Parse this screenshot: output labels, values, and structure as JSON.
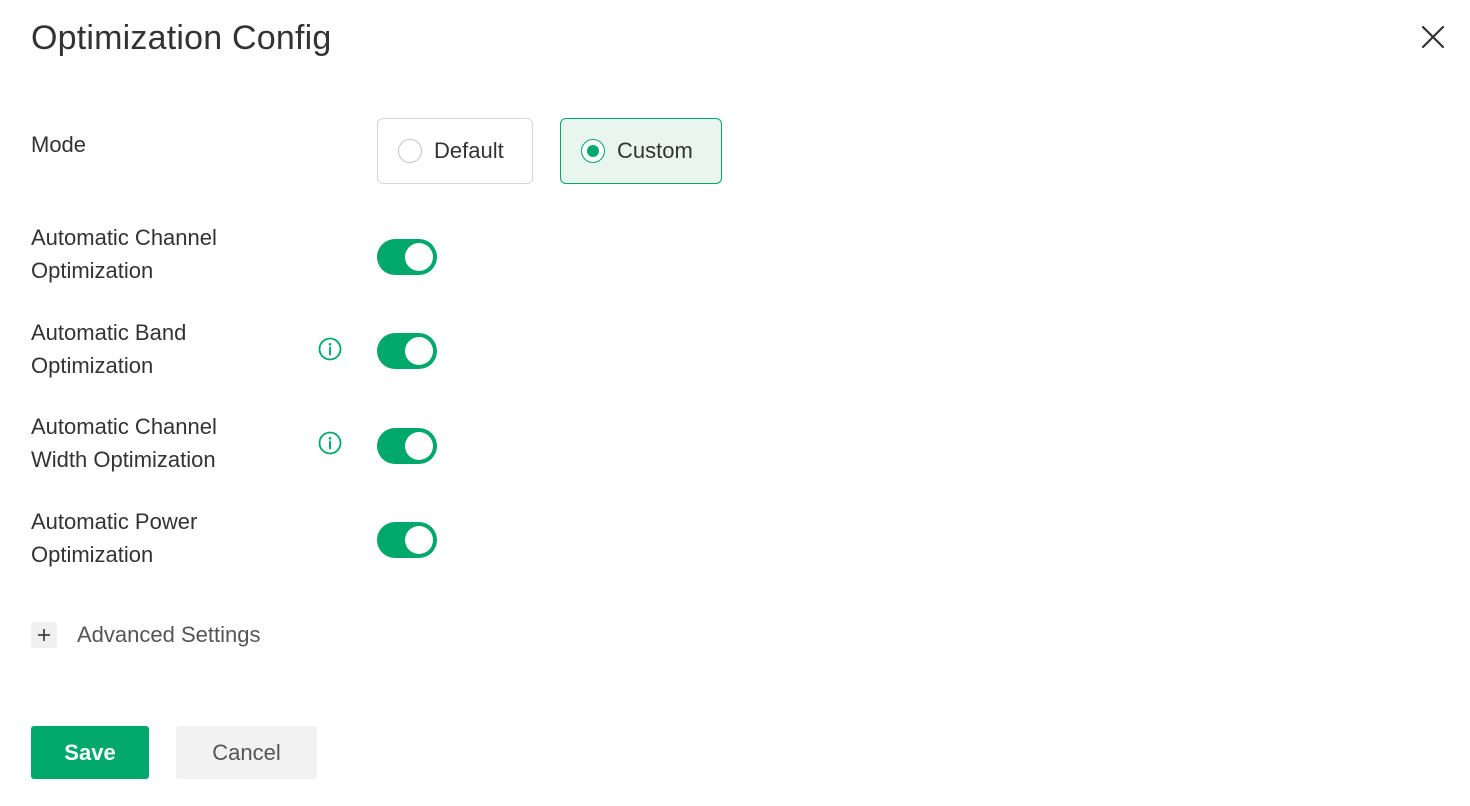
{
  "dialog": {
    "title": "Optimization Config"
  },
  "mode": {
    "label": "Mode",
    "options": [
      {
        "label": "Default",
        "selected": false
      },
      {
        "label": "Custom",
        "selected": true
      }
    ]
  },
  "settings": [
    {
      "label_line1": "Automatic Channel",
      "label_line2": "Optimization",
      "has_info": false,
      "enabled": true
    },
    {
      "label_line1": "Automatic Band",
      "label_line2": "Optimization",
      "has_info": true,
      "enabled": true
    },
    {
      "label_line1": "Automatic Channel",
      "label_line2": "Width Optimization",
      "has_info": true,
      "enabled": true
    },
    {
      "label_line1": "Automatic Power",
      "label_line2": "Optimization",
      "has_info": false,
      "enabled": true
    }
  ],
  "advanced": {
    "label": "Advanced Settings",
    "expanded": false
  },
  "actions": {
    "save_label": "Save",
    "cancel_label": "Cancel"
  },
  "colors": {
    "accent": "#00a86b",
    "accent_light": "#e8f6ef",
    "text": "#333333"
  },
  "icons": {
    "close": "close-icon",
    "info": "info-icon",
    "expand": "plus-icon"
  }
}
